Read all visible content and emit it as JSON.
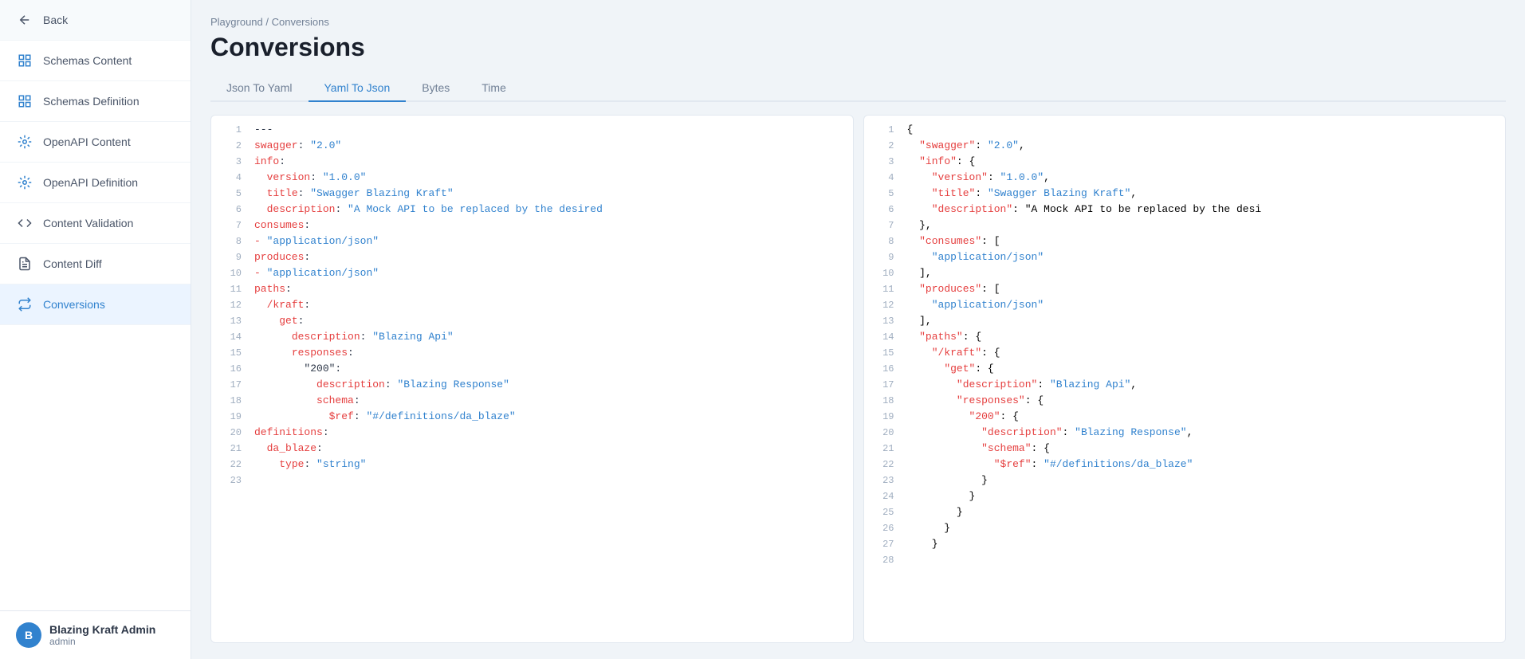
{
  "sidebar": {
    "back_label": "Back",
    "items": [
      {
        "id": "schemas-content",
        "label": "Schemas Content",
        "icon": "grid-icon"
      },
      {
        "id": "schemas-definition",
        "label": "Schemas Definition",
        "icon": "grid-icon"
      },
      {
        "id": "openapi-content",
        "label": "OpenAPI Content",
        "icon": "settings-icon"
      },
      {
        "id": "openapi-definition",
        "label": "OpenAPI Definition",
        "icon": "settings-icon"
      },
      {
        "id": "content-validation",
        "label": "Content Validation",
        "icon": "code-icon"
      },
      {
        "id": "content-diff",
        "label": "Content Diff",
        "icon": "file-icon"
      },
      {
        "id": "conversions",
        "label": "Conversions",
        "icon": "convert-icon",
        "active": true
      }
    ],
    "user": {
      "name": "Blazing Kraft Admin",
      "role": "admin",
      "avatar_letter": "B"
    }
  },
  "breadcrumb": {
    "parts": [
      "Playground",
      "/",
      "Conversions"
    ]
  },
  "page": {
    "title": "Conversions"
  },
  "tabs": [
    {
      "id": "json-to-yaml",
      "label": "Json To Yaml"
    },
    {
      "id": "yaml-to-json",
      "label": "Yaml To Json",
      "active": true
    },
    {
      "id": "bytes",
      "label": "Bytes"
    },
    {
      "id": "time",
      "label": "Time"
    }
  ],
  "left_panel": {
    "lines": [
      {
        "num": 1,
        "content": "---"
      },
      {
        "num": 2,
        "content": "swagger: \"2.0\""
      },
      {
        "num": 3,
        "content": "info:"
      },
      {
        "num": 4,
        "content": "  version: \"1.0.0\""
      },
      {
        "num": 5,
        "content": "  title: \"Swagger Blazing Kraft\""
      },
      {
        "num": 6,
        "content": "  description: \"A Mock API to be replaced by the desired"
      },
      {
        "num": 7,
        "content": "consumes:"
      },
      {
        "num": 8,
        "content": "- \"application/json\""
      },
      {
        "num": 9,
        "content": "produces:"
      },
      {
        "num": 10,
        "content": "- \"application/json\""
      },
      {
        "num": 11,
        "content": "paths:"
      },
      {
        "num": 12,
        "content": "  /kraft:"
      },
      {
        "num": 13,
        "content": "    get:"
      },
      {
        "num": 14,
        "content": "      description: \"Blazing Api\""
      },
      {
        "num": 15,
        "content": "      responses:"
      },
      {
        "num": 16,
        "content": "        \"200\":"
      },
      {
        "num": 17,
        "content": "          description: \"Blazing Response\""
      },
      {
        "num": 18,
        "content": "          schema:"
      },
      {
        "num": 19,
        "content": "            $ref: \"#/definitions/da_blaze\""
      },
      {
        "num": 20,
        "content": "definitions:"
      },
      {
        "num": 21,
        "content": "  da_blaze:"
      },
      {
        "num": 22,
        "content": "    type: \"string\""
      },
      {
        "num": 23,
        "content": ""
      }
    ]
  },
  "right_panel": {
    "lines": [
      {
        "num": 1,
        "content": "{"
      },
      {
        "num": 2,
        "content": "  \"swagger\": \"2.0\","
      },
      {
        "num": 3,
        "content": "  \"info\": {"
      },
      {
        "num": 4,
        "content": "    \"version\": \"1.0.0\","
      },
      {
        "num": 5,
        "content": "    \"title\": \"Swagger Blazing Kraft\","
      },
      {
        "num": 6,
        "content": "    \"description\": \"A Mock API to be replaced by the desi"
      },
      {
        "num": 7,
        "content": "  },"
      },
      {
        "num": 8,
        "content": "  \"consumes\": ["
      },
      {
        "num": 9,
        "content": "    \"application/json\""
      },
      {
        "num": 10,
        "content": "  ],"
      },
      {
        "num": 11,
        "content": "  \"produces\": ["
      },
      {
        "num": 12,
        "content": "    \"application/json\""
      },
      {
        "num": 13,
        "content": "  ],"
      },
      {
        "num": 14,
        "content": "  \"paths\": {"
      },
      {
        "num": 15,
        "content": "    \"/kraft\": {"
      },
      {
        "num": 16,
        "content": "      \"get\": {"
      },
      {
        "num": 17,
        "content": "        \"description\": \"Blazing Api\","
      },
      {
        "num": 18,
        "content": "        \"responses\": {"
      },
      {
        "num": 19,
        "content": "          \"200\": {"
      },
      {
        "num": 20,
        "content": "            \"description\": \"Blazing Response\","
      },
      {
        "num": 21,
        "content": "            \"schema\": {"
      },
      {
        "num": 22,
        "content": "              \"$ref\": \"#/definitions/da_blaze\""
      },
      {
        "num": 23,
        "content": "            }"
      },
      {
        "num": 24,
        "content": "          }"
      },
      {
        "num": 25,
        "content": "        }"
      },
      {
        "num": 26,
        "content": "      }"
      },
      {
        "num": 27,
        "content": "    }"
      },
      {
        "num": 28,
        "content": ""
      }
    ]
  }
}
